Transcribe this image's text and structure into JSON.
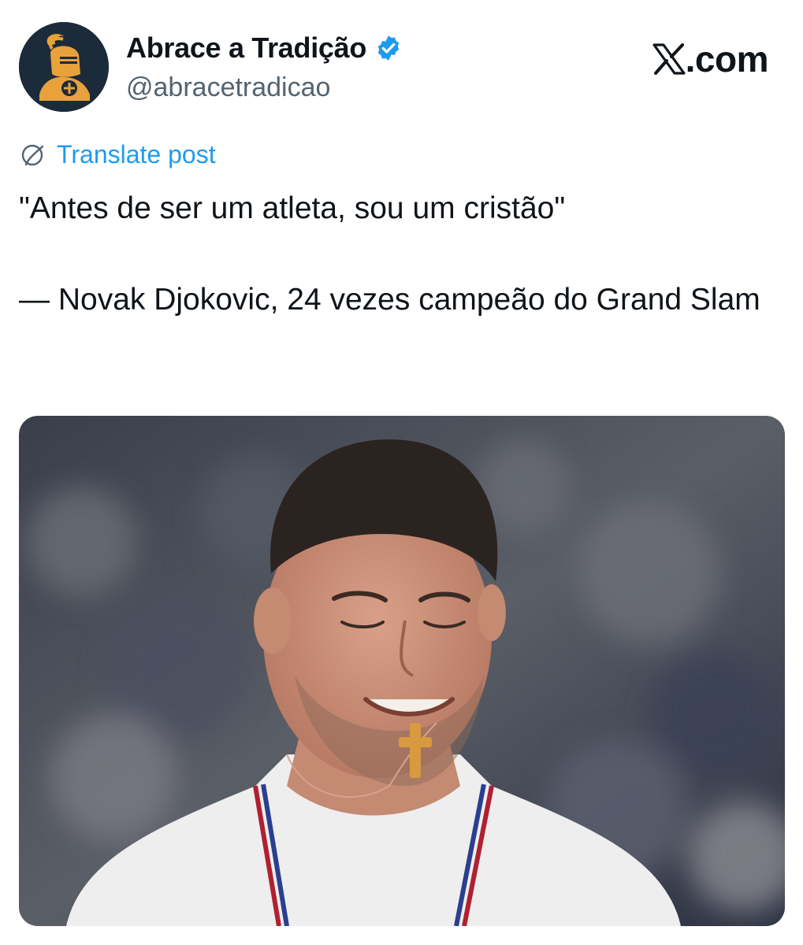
{
  "post": {
    "author": {
      "display_name": "Abrace a Tradição",
      "handle": "@abracetradicao",
      "verified": true,
      "avatar_icon": "knight-helmet-icon"
    },
    "site": {
      "icon": "x-logo-icon",
      "text": ".com"
    },
    "translate": {
      "icon": "globe-icon",
      "label": "Translate post"
    },
    "text_lines": [
      "\"Antes de ser um atleta, sou um cristão\"",
      "— Novak Djokovic, 24 vezes campeão do Grand Slam"
    ],
    "media": {
      "type": "photo"
    }
  },
  "colors": {
    "link_blue": "#1d9bf0",
    "text_primary": "#0f1419",
    "text_secondary": "#536471",
    "avatar_bg": "#1c2b39",
    "avatar_gold": "#e9a23b"
  }
}
